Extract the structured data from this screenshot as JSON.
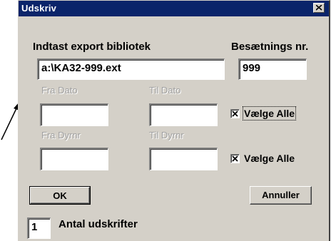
{
  "window": {
    "title": "Udskriv",
    "close_icon": "close-x-icon"
  },
  "export": {
    "label": "Indtast export bibliotek",
    "value": "a:\\KA32-999.ext"
  },
  "besaetning": {
    "label": "Besætnings nr.",
    "value": "999"
  },
  "date_range": {
    "from_label": "Fra Dato",
    "to_label": "Til Dato",
    "from_value": "",
    "to_value": "",
    "select_all_label": "Vælge Alle",
    "select_all_checked": true
  },
  "animal_range": {
    "from_label": "Fra Dyrnr",
    "to_label": "Til Dyrnr",
    "from_value": "",
    "to_value": "",
    "select_all_label": "Vælge Alle",
    "select_all_checked": true
  },
  "buttons": {
    "ok_label": "OK",
    "cancel_label": "Annuller"
  },
  "copies": {
    "value": "1",
    "label": "Antal udskrifter"
  },
  "colors": {
    "titlebar": "#0a246a",
    "face": "#d4d0c8",
    "disabled_text": "#a0a0a0"
  }
}
